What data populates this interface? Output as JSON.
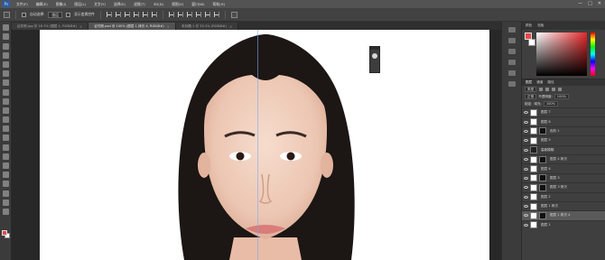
{
  "app": {
    "logo": "Ps",
    "menu": [
      "文件(F)",
      "编辑(E)",
      "图像(I)",
      "图层(L)",
      "文字(Y)",
      "选择(S)",
      "滤镜(T)",
      "3D(D)",
      "视图(V)",
      "窗口(W)",
      "帮助(H)"
    ],
    "window_controls": [
      "—",
      "□",
      "✕"
    ]
  },
  "options_bar": {
    "auto_select_label": "自动选择:",
    "auto_select_value": "图层",
    "show_transform_label": "显示变换控件"
  },
  "tabs": [
    {
      "label": "证件照.jpg @ 16.7% (图层 1, RGB/8#)",
      "active": false
    },
    {
      "label": "证件照.psd @ 100% (图层 1 拷贝 4, RGB/8#)",
      "active": true
    },
    {
      "label": "未标题-1 @ 33.3% (RGB/8#)",
      "active": false
    }
  ],
  "panels": {
    "color_tabs": [
      "颜色",
      "色板"
    ],
    "layers_tabs": [
      "图层",
      "通道",
      "路径"
    ],
    "filter_kind": "类型",
    "blend_mode": "正常",
    "opacity_label": "不透明度:",
    "opacity_value": "100%",
    "lock_label": "锁定:",
    "fill_label": "填充:",
    "fill_value": "100%"
  },
  "layers": [
    {
      "name": "图层 7",
      "selected": false,
      "thumb": "light",
      "mask": false
    },
    {
      "name": "图层 6",
      "selected": false,
      "thumb": "light",
      "mask": false
    },
    {
      "name": "色阶 1",
      "selected": false,
      "thumb": "light",
      "mask": true
    },
    {
      "name": "图层 5",
      "selected": false,
      "thumb": "light",
      "mask": false
    },
    {
      "name": "高斯模糊",
      "selected": false,
      "thumb": "dark",
      "mask": false
    },
    {
      "name": "图层 4 拷贝",
      "selected": false,
      "thumb": "light",
      "mask": true
    },
    {
      "name": "图层 4",
      "selected": false,
      "thumb": "light",
      "mask": false
    },
    {
      "name": "图层 3",
      "selected": false,
      "thumb": "light",
      "mask": true
    },
    {
      "name": "图层 3 拷贝",
      "selected": false,
      "thumb": "light",
      "mask": true
    },
    {
      "name": "图层 2",
      "selected": false,
      "thumb": "light",
      "mask": false
    },
    {
      "name": "图层 1 拷贝",
      "selected": false,
      "thumb": "light",
      "mask": false
    },
    {
      "name": "图层 1 拷贝 4",
      "selected": true,
      "thumb": "light",
      "mask": true
    },
    {
      "name": "图层 1",
      "selected": false,
      "thumb": "light",
      "mask": false
    }
  ],
  "colors": {
    "foreground": "#e8484a",
    "background": "#ffffff",
    "ui_dark": "#2b2b2b"
  }
}
